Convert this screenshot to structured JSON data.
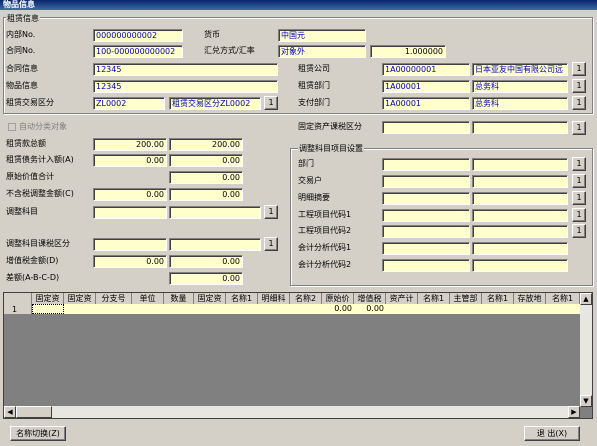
{
  "window": {
    "title": "物品信息"
  },
  "lease_group": {
    "title": "租赁信息"
  },
  "fields": {
    "internal_no": {
      "label": "内部No.",
      "value": "000000000002"
    },
    "currency": {
      "label": "货币",
      "value": "中国元"
    },
    "contract_no": {
      "label": "合同No.",
      "value": "100-000000000002"
    },
    "exchange": {
      "label": "汇兑方式/汇率",
      "value": "对象外",
      "rate": "1.000000"
    },
    "contract_info": {
      "label": "合同信息",
      "value": "12345"
    },
    "lease_company": {
      "label": "租赁公司",
      "code": "1A00000001",
      "name": "日本亚友中国有限公司远"
    },
    "item_info": {
      "label": "物品信息",
      "value": "12345"
    },
    "lease_dept": {
      "label": "租赁部门",
      "code": "1A00001",
      "name": "总务科"
    },
    "lease_type": {
      "label": "租赁交易区分",
      "code": "ZL0002",
      "name": "租赁交易区分ZL0002"
    },
    "pay_dept": {
      "label": "支付部门",
      "code": "1A00001",
      "name": "总务科"
    }
  },
  "auto_classify": {
    "label": "自动分类对象"
  },
  "fixed_tax": {
    "label": "固定资产课税区分"
  },
  "amounts": {
    "total": {
      "label": "租赁款总额",
      "v1": "200.00",
      "v2": "200.00"
    },
    "debt": {
      "label": "租赁债务计入额(A)",
      "v1": "0.00",
      "v2": "0.00"
    },
    "orig_total": {
      "label": "原始价值合计",
      "v2": "0.00"
    },
    "non_tax": {
      "label": "不含税调整金额(C)",
      "v1": "0.00",
      "v2": "0.00"
    },
    "adj_subject": {
      "label": "调整科目"
    },
    "adj_tax": {
      "label": "调整科目课税区分"
    },
    "vat": {
      "label": "增值税金额(D)",
      "v1": "0.00",
      "v2": "0.00"
    },
    "diff": {
      "label": "差额(A-B-C-D)",
      "v2": "0.00"
    }
  },
  "adj_group": {
    "title": "调整科目项目设置",
    "items": [
      "部门",
      "交易户",
      "明细摘要",
      "工程项目代码1",
      "工程项目代码2",
      "会计分析代码1",
      "会计分析代码2"
    ]
  },
  "grid": {
    "headers": [
      "固定资",
      "固定资",
      "分支号",
      "单位",
      "数量",
      "固定资",
      "名称1",
      "明细科",
      "名称2",
      "原始价",
      "增值税",
      "资产计",
      "名称1",
      "主管部",
      "名称1",
      "存放地",
      "名称1"
    ],
    "row_no": "1",
    "row_values": {
      "orig": "0.00",
      "vat": "0.00"
    }
  },
  "buttons": {
    "switch_name": "名称切换(Z)",
    "exit": "退 出(X)",
    "ellipsis": "1"
  }
}
